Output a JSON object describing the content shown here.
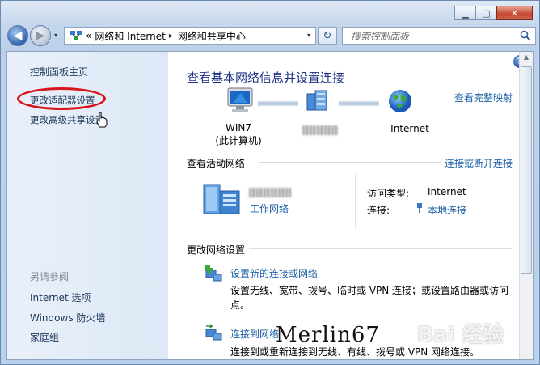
{
  "window": {
    "minimize": "▁",
    "maximize": "□",
    "close": "✕"
  },
  "nav": {
    "back_icon": "◀",
    "forward_icon": "▶",
    "history_icon": "▾",
    "address": {
      "prefix": "«",
      "crumbs": [
        "网络和 Internet",
        "网络和共享中心"
      ],
      "separator": "▸",
      "dropdown_icon": "▾"
    },
    "refresh_icon": "↻",
    "search_placeholder": "搜索控制面板"
  },
  "left": {
    "home": "控制面板主页",
    "change_adapter": "更改适配器设置",
    "change_sharing": "更改高级共享设置",
    "see_also": "另请参阅",
    "links": [
      "Internet 选项",
      "Windows 防火墙",
      "家庭组"
    ]
  },
  "main": {
    "help": "?",
    "title": "查看基本网络信息并设置连接",
    "full_map": "查看完整映射",
    "map": {
      "computer_line1": "WIN7",
      "computer_line2": "(此计算机)",
      "internet": "Internet"
    },
    "active_header": "查看活动网络",
    "connect_disconnect": "连接或断开连接",
    "network_type": "工作网络",
    "access_label": "访问类型:",
    "access_value": "Internet",
    "connection_label": "连接:",
    "connection_value": "本地连接",
    "change_header": "更改网络设置",
    "tasks": [
      {
        "link": "设置新的连接或网络",
        "desc_line1": "设置无线、宽带、拨号、临时或 VPN 连接；或设置路由器或访问",
        "desc_line2": "点。"
      },
      {
        "link": "连接到网络",
        "desc_line1": "连接到或重新连接到无线、有线、拨号或 VPN 网络连接。",
        "desc_line2": ""
      }
    ]
  },
  "watermark": {
    "author": "Merlin67",
    "site": "Bai 经验"
  },
  "colors": {
    "link": "#1c5fa6",
    "title": "#1e3287",
    "highlight": "#d8161a"
  }
}
